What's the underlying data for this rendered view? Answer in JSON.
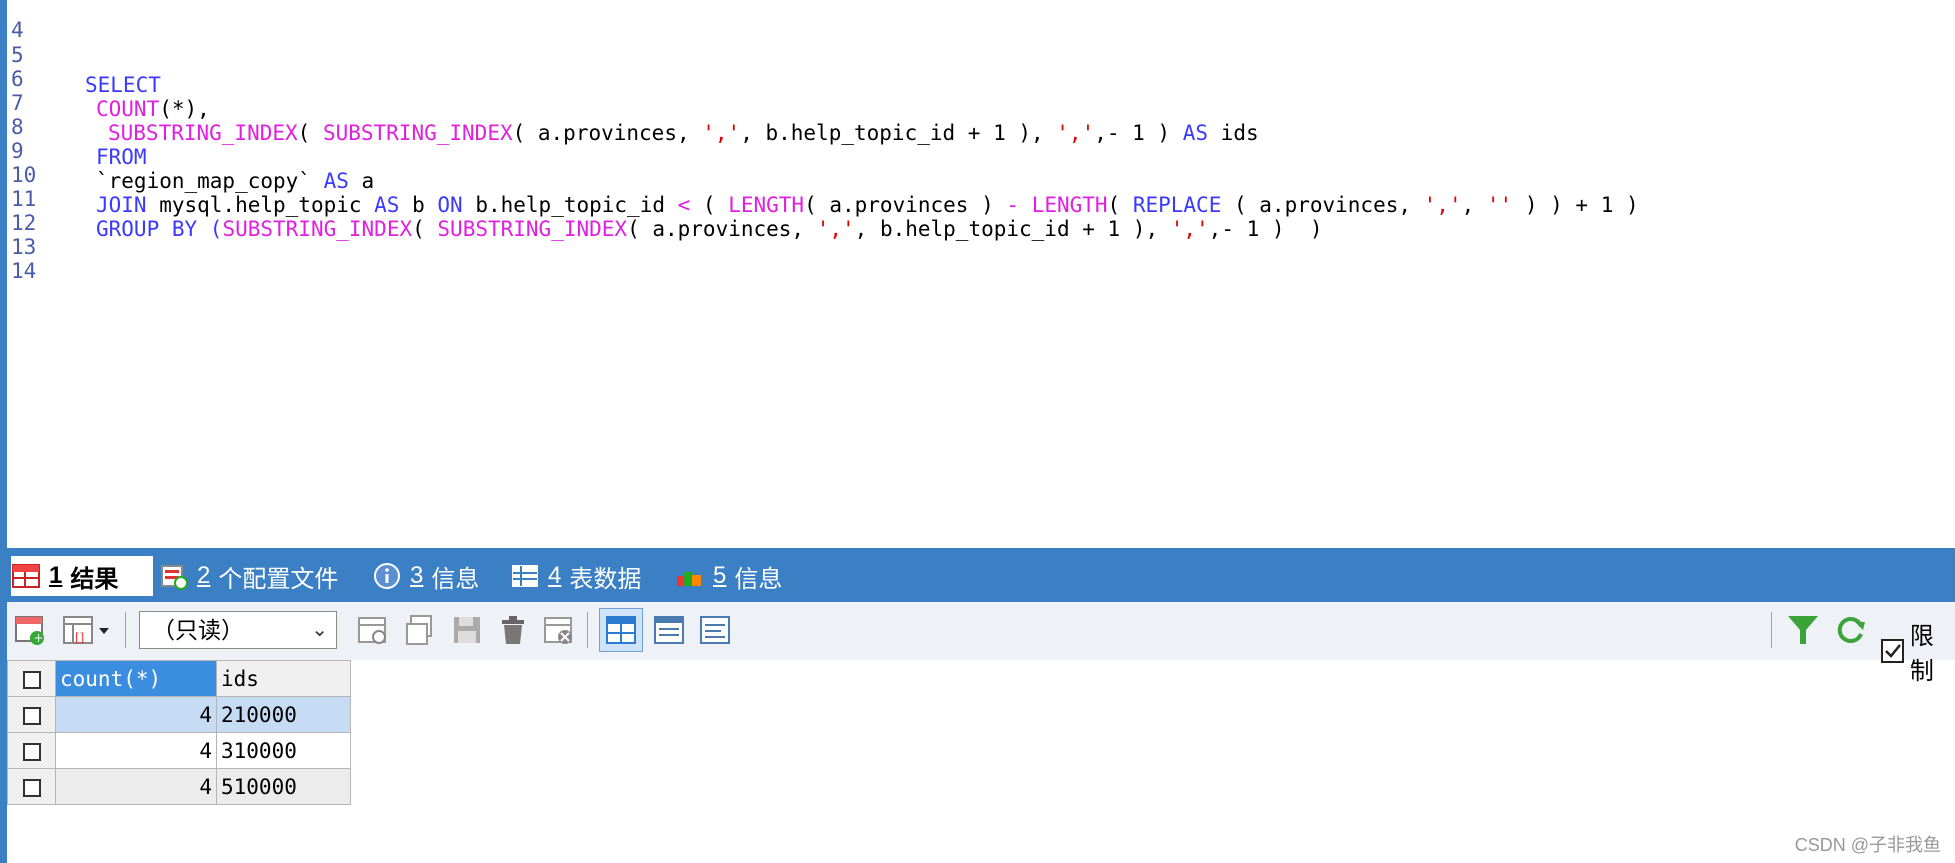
{
  "editor": {
    "lines": [
      {
        "n": "4"
      },
      {
        "n": "5"
      },
      {
        "n": "6"
      },
      {
        "n": "7"
      },
      {
        "n": "8"
      },
      {
        "n": "9"
      },
      {
        "n": "10"
      },
      {
        "n": "11"
      },
      {
        "n": "12"
      },
      {
        "n": "13"
      },
      {
        "n": "14"
      }
    ],
    "code": {
      "l5": "SELECT",
      "l6a": "COUNT",
      "l6b": "(*),",
      "l7a": "SUBSTRING_INDEX",
      "l7b": "( ",
      "l7c": "SUBSTRING_INDEX",
      "l7d": "( a.provinces, ",
      "l7e": "','",
      "l7f": ", b.help_topic_id + 1 ), ",
      "l7g": "','",
      "l7h": ",- 1 ) ",
      "l7i": "AS",
      "l7j": " ids",
      "l8": "FROM",
      "l9a": "`region_map_copy` ",
      "l9b": "AS",
      "l9c": " a",
      "l10a": "JOIN",
      "l10b": " mysql.help_topic ",
      "l10c": "AS",
      "l10d": " b ",
      "l10e": "ON",
      "l10f": " b.help_topic_id ",
      "l10g": "<",
      "l10h": " ( ",
      "l10i": "LENGTH",
      "l10j": "( a.provinces ) ",
      "l10k": "-",
      "l10l": " ",
      "l10m": "LENGTH",
      "l10n": "( ",
      "l10o": "REPLACE",
      "l10p": " ( a.provinces, ",
      "l10q": "','",
      "l10r": ", ",
      "l10s": "''",
      "l10t": " ) ) + 1 )",
      "l11a": "GROUP BY",
      "l11b": " (",
      "l11c": "SUBSTRING_INDEX",
      "l11d": "( ",
      "l11e": "SUBSTRING_INDEX",
      "l11f": "( a.provinces, ",
      "l11g": "','",
      "l11h": ", b.help_topic_id + 1 ), ",
      "l11i": "','",
      "l11j": ",- 1 )  )"
    }
  },
  "tabs": [
    {
      "num": "1",
      "label": "结果",
      "icon": "result-grid-icon"
    },
    {
      "num": "2",
      "label": "个配置文件",
      "icon": "profile-icon"
    },
    {
      "num": "3",
      "label": "信息",
      "icon": "info-icon"
    },
    {
      "num": "4",
      "label": "表数据",
      "icon": "table-data-icon"
    },
    {
      "num": "5",
      "label": "信息",
      "icon": "history-info-icon"
    }
  ],
  "toolbar": {
    "mode_select": "（只读）",
    "limit_label": "限制"
  },
  "grid": {
    "columns": [
      "count(*)",
      "ids"
    ],
    "rows": [
      {
        "count": "4",
        "ids": "210000"
      },
      {
        "count": "4",
        "ids": "310000"
      },
      {
        "count": "4",
        "ids": "510000"
      }
    ]
  },
  "watermark": "CSDN @子非我鱼",
  "colors": {
    "accent": "#3b7fc4",
    "keyword": "#3a3aff",
    "function": "#e020e0",
    "string": "#e00000",
    "selected_row": "#c6dcf5"
  }
}
